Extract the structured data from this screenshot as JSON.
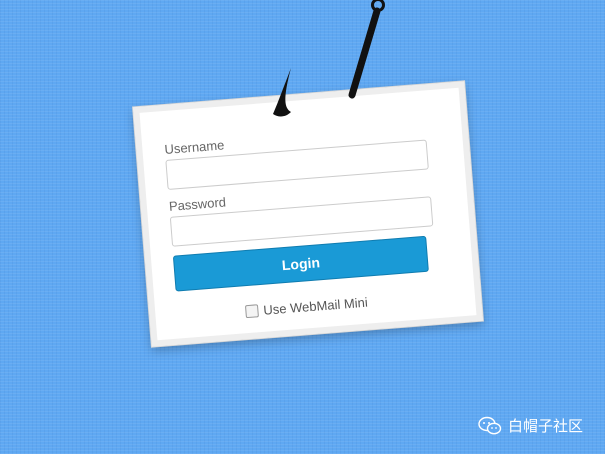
{
  "login_card": {
    "username_label": "Username",
    "username_value": "",
    "password_label": "Password",
    "password_value": "",
    "login_button_label": "Login",
    "remember_label": "Use WebMail Mini",
    "remember_checked": false
  },
  "watermark": {
    "text": "白帽子社区",
    "icon": "wechat-icon"
  },
  "colors": {
    "background": "#5fa8f2",
    "button": "#1a9ad6",
    "hook": "#111111"
  }
}
